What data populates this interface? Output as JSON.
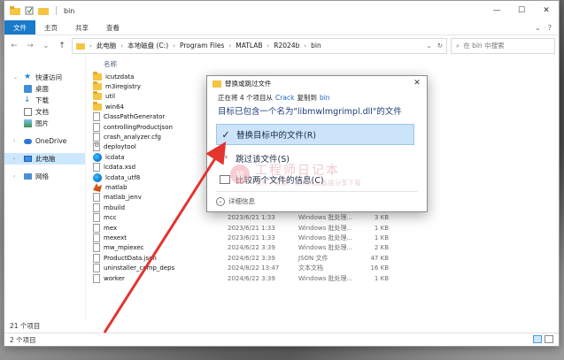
{
  "window": {
    "title": "bin",
    "controls": {
      "minimize": "—",
      "maximize": "☐",
      "close": "✕"
    }
  },
  "ribbon": {
    "tabs": [
      "文件",
      "主页",
      "共享",
      "查看"
    ],
    "expand_icon": "chevron-down-icon",
    "help_icon": "help-icon"
  },
  "address": {
    "segments": [
      "此电脑",
      "本地磁盘 (C:)",
      "Program Files",
      "MATLAB",
      "R2024b",
      "bin"
    ],
    "search_placeholder": "在 bin 中搜索"
  },
  "nav": {
    "items": [
      {
        "label": "快速访问",
        "icon": "star-icon",
        "level": 0
      },
      {
        "label": "桌面",
        "icon": "desktop-icon",
        "level": 1
      },
      {
        "label": "下载",
        "icon": "download-icon",
        "level": 1
      },
      {
        "label": "文档",
        "icon": "document-icon",
        "level": 1
      },
      {
        "label": "图片",
        "icon": "picture-icon",
        "level": 1
      },
      {
        "label": "OneDrive",
        "icon": "cloud-icon",
        "level": 0
      },
      {
        "label": "此电脑",
        "icon": "computer-icon",
        "level": 0,
        "selected": true
      },
      {
        "label": "网络",
        "icon": "network-icon",
        "level": 0
      }
    ]
  },
  "files": {
    "headers": {
      "name": "名称",
      "date": "",
      "type": "",
      "size": ""
    },
    "rows": [
      {
        "name": "icutzdata",
        "kind": "folder",
        "date": "",
        "type": "",
        "size": ""
      },
      {
        "name": "m3iregistry",
        "kind": "folder",
        "date": "",
        "type": "",
        "size": ""
      },
      {
        "name": "util",
        "kind": "folder",
        "date": "",
        "type": "",
        "size": ""
      },
      {
        "name": "win64",
        "kind": "folder",
        "date": "",
        "type": "",
        "size": ""
      },
      {
        "name": "ClassPathGenerator",
        "kind": "file",
        "date": "",
        "type": "",
        "size": ""
      },
      {
        "name": "controllingProductjson",
        "kind": "file",
        "date": "",
        "type": "",
        "size": ""
      },
      {
        "name": "crash_analyzer.cfg",
        "kind": "file",
        "date": "",
        "type": "",
        "size": ""
      },
      {
        "name": "deploytool",
        "kind": "gear",
        "date": "",
        "type": "",
        "size": ""
      },
      {
        "name": "lcdata",
        "kind": "edge",
        "date": "",
        "type": "",
        "size": ""
      },
      {
        "name": "lcdata.xsd",
        "kind": "file",
        "date": "",
        "type": "",
        "size": ""
      },
      {
        "name": "lcdata_utf8",
        "kind": "edge",
        "date": "",
        "type": "",
        "size": ""
      },
      {
        "name": "matlab",
        "kind": "matlab",
        "date": "",
        "type": "",
        "size": ""
      },
      {
        "name": "matlab_jenv",
        "kind": "file",
        "date": "",
        "type": "",
        "size": ""
      },
      {
        "name": "mbuild",
        "kind": "file",
        "date": "",
        "type": "",
        "size": ""
      },
      {
        "name": "mcc",
        "kind": "file",
        "date": "2023/6/21 1:33",
        "type": "Windows 批处理...",
        "size": "3 KB"
      },
      {
        "name": "mex",
        "kind": "file",
        "date": "2023/6/21 1:33",
        "type": "Windows 批处理...",
        "size": "1 KB"
      },
      {
        "name": "mexext",
        "kind": "file",
        "date": "2023/6/21 1:33",
        "type": "Windows 批处理...",
        "size": "1 KB"
      },
      {
        "name": "mw_mpiexec",
        "kind": "file",
        "date": "2024/6/22 3:39",
        "type": "Windows 批处理...",
        "size": "2 KB"
      },
      {
        "name": "ProductData.json",
        "kind": "file",
        "date": "2024/6/22 3:39",
        "type": "JSON 文件",
        "size": "47 KB"
      },
      {
        "name": "uninstaller_comp_deps",
        "kind": "file",
        "date": "2024/8/22 13:47",
        "type": "文本文档",
        "size": "16 KB"
      },
      {
        "name": "worker",
        "kind": "file",
        "date": "2024/6/22 3:39",
        "type": "Windows 批处理...",
        "size": "1 KB"
      }
    ]
  },
  "status": {
    "count": "21 个项目",
    "selected": "2 个项目"
  },
  "dialog": {
    "title": "替换或跳过文件",
    "sub_prefix": "正在将 4 个项目从",
    "source": "Crack",
    "sub_mid": "复制到",
    "dest": "bin",
    "heading": "目标已包含一个名为\"libmwlmgrimpl.dll\"的文件",
    "options": [
      {
        "label": "替换目标中的文件(R)",
        "icon": "check-icon",
        "selected": true
      },
      {
        "label": "跳过该文件(S)",
        "icon": "skip-icon",
        "selected": false
      },
      {
        "label": "比较两个文件的信息(C)",
        "icon": "compare-icon",
        "selected": false
      }
    ],
    "details": "详细信息",
    "close": "✕"
  },
  "watermark": {
    "mark": "软",
    "title": "工程师日记本",
    "subtitle": "软件、资源、资料网盘直接分享下载"
  },
  "colors": {
    "accent": "#1979ca",
    "selection": "#cce8ff",
    "dialog_selection": "#cbe4fa",
    "arrow": "#e3342f"
  }
}
